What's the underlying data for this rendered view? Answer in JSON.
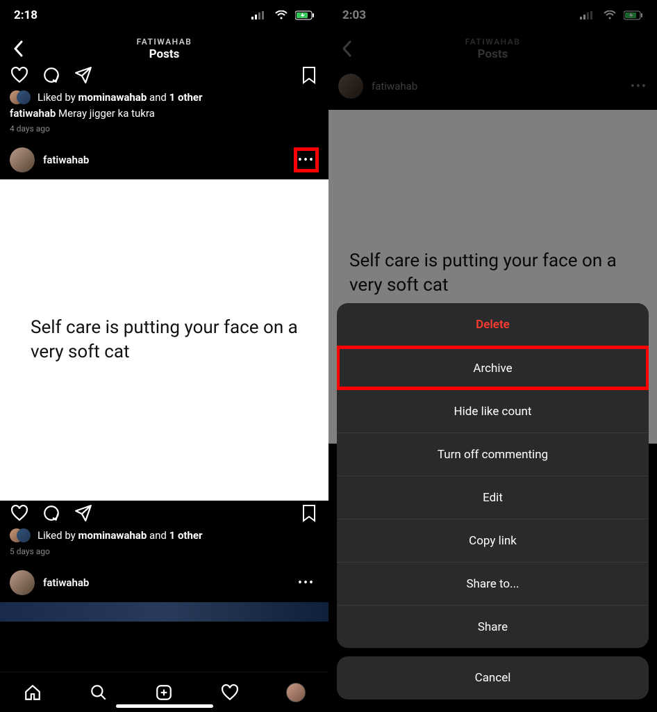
{
  "left": {
    "status_time": "2:18",
    "nav_sub": "FATIWAHAB",
    "nav_main": "Posts",
    "like_prefix": "Liked by ",
    "like_name": "mominawahab",
    "like_mid": " and ",
    "like_rest": "1 other",
    "cap_user": "fatiwahab",
    "cap_text": " Meray jigger ka tukra",
    "cap_time": "4 days ago",
    "post2_user": "fatiwahab",
    "post2_text": "Self care is putting your face on a very soft cat",
    "like2_prefix": "Liked by ",
    "like2_name": "mominawahab",
    "like2_mid": " and ",
    "like2_rest": "1 other",
    "time2": "5 days ago",
    "post3_user": "fatiwahab",
    "more": "•••"
  },
  "right": {
    "status_time": "2:03",
    "nav_sub": "FATIWAHAB",
    "nav_main": "Posts",
    "post_user": "fatiwahab",
    "post_text": "Self care is putting your face on a very soft cat",
    "more": "•••",
    "menu": {
      "delete": "Delete",
      "archive": "Archive",
      "hide": "Hide like count",
      "turnoff": "Turn off commenting",
      "edit": "Edit",
      "copy": "Copy link",
      "shareto": "Share to...",
      "share": "Share",
      "cancel": "Cancel"
    }
  }
}
